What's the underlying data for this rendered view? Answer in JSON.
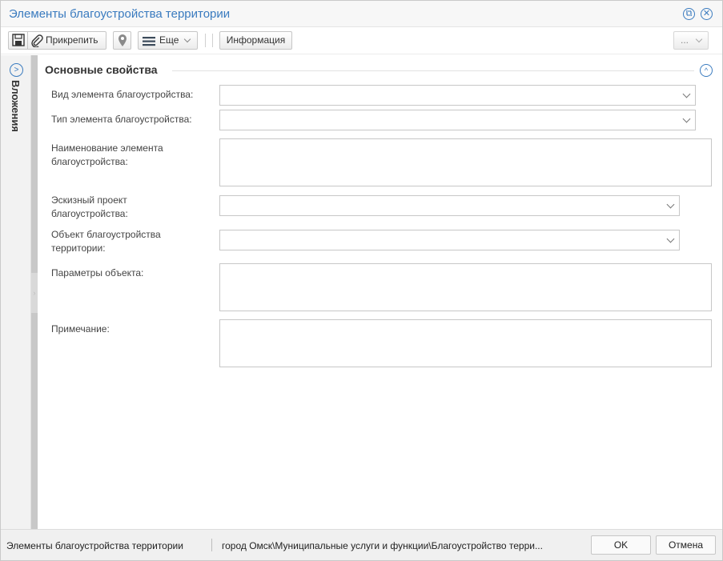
{
  "window": {
    "title": "Элементы благоустройства территории"
  },
  "toolbar": {
    "save_icon": "save-icon",
    "attach_label": "Прикрепить",
    "location_icon": "map-pin-icon",
    "more_label": "Еще",
    "info_label": "Информация",
    "extra_label": "..."
  },
  "sidebar": {
    "attachments_label": "Вложения"
  },
  "form": {
    "section_title": "Основные свойства",
    "fields": [
      {
        "label": "Вид элемента благоустройства:",
        "value": "",
        "type": "select"
      },
      {
        "label": "Тип элемента благоустройства:",
        "value": "",
        "type": "select"
      },
      {
        "label": "Наименование элемента благоустройства:",
        "value": "",
        "type": "textarea"
      },
      {
        "label": "Эскизный проект благоустройства:",
        "value": "",
        "type": "select"
      },
      {
        "label": "Объект благоустройства территории:",
        "value": "",
        "type": "select"
      },
      {
        "label": "Параметры объекта:",
        "value": "",
        "type": "textarea"
      },
      {
        "label": "Примечание:",
        "value": "",
        "type": "textarea"
      }
    ]
  },
  "statusbar": {
    "entity": "Элементы благоустройства территории",
    "path": "город Омск\\Муниципальные услуги и функции\\Благоустройство терри...",
    "ok_label": "OK",
    "cancel_label": "Отмена"
  },
  "colors": {
    "accent": "#3a7bbf",
    "splitter": "#c8c8c8",
    "statusbar_bg": "#f0f0f0"
  }
}
